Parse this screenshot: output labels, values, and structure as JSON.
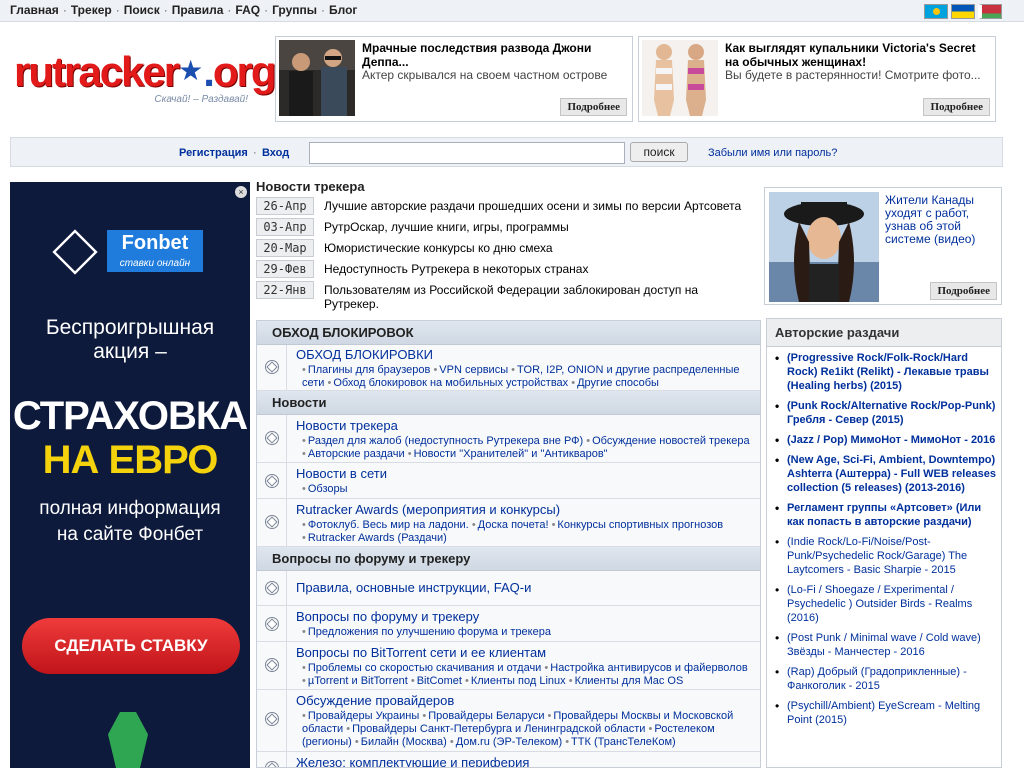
{
  "nav": {
    "items": [
      "Главная",
      "Трекер",
      "Поиск",
      "Правила",
      "FAQ",
      "Группы",
      "Блог"
    ],
    "sep": "·"
  },
  "logo": {
    "part1": "rutracker",
    "star": "★",
    "part2": "org",
    "dot": ".",
    "tagline": "Скачай! – Раздавай!"
  },
  "top_ads": [
    {
      "title": "Мрачные последствия развода Джони Деппа...",
      "desc": "Актер скрывался на своем частном острове",
      "more": "Подробнее"
    },
    {
      "title": "Как выглядят купальники Victoria's Secret на обычных женщинах!",
      "desc": "Вы будете в растерянности! Смотрите фото...",
      "more": "Подробнее"
    }
  ],
  "login": {
    "register": "Регистрация",
    "dot": "·",
    "enter": "Вход",
    "search_value": "",
    "search_button": "поиск",
    "forgot": "Забыли имя или пароль?"
  },
  "banner": {
    "close": "×",
    "brand": "Fonbet",
    "brand_sub": "ставки онлайн",
    "line1": "Беспроигрышная",
    "line2": "акция –",
    "big1": "СТРАХОВКА",
    "big2": "НА ЕВРО",
    "line3": "полная информация",
    "line4": "на сайте Фонбет",
    "cta": "СДЕЛАТЬ СТАВКУ"
  },
  "news": {
    "title": "Новости трекера",
    "items": [
      {
        "date": "26-Апр",
        "text": "Лучшие авторские раздачи прошедших осени и зимы по версии Артсовета"
      },
      {
        "date": "03-Апр",
        "text": "РутрОскар, лучшие книги, игры, программы"
      },
      {
        "date": "20-Мар",
        "text": "Юмористические конкурсы ко дню смеха"
      },
      {
        "date": "29-Фев",
        "text": "Недоступность Рутрекера в некоторых странах"
      },
      {
        "date": "22-Янв",
        "text": "Пользователям из Российской Федерации заблокирован доступ на Рутрекер."
      }
    ]
  },
  "right_ad": {
    "title": "Жители Канады уходят с работ, узнав об этой системе (видео)",
    "more": "Подробнее"
  },
  "forum": {
    "cat1": "ОБХОД БЛОКИРОВОК",
    "f1": {
      "name": "ОБХОД БЛОКИРОВКИ",
      "sub1": "Плагины для браузеров",
      "sub2": "VPN сервисы",
      "sub3": "TOR, I2P, ONION и другие распределенные сети",
      "sub4": "Обход блокировок на мобильных устройствах",
      "sub5": "Другие способы"
    },
    "cat2": "Новости",
    "f2": {
      "name": "Новости трекера",
      "sub1": "Раздел для жалоб (недоступность Рутрекера вне РФ)",
      "sub2": "Обсуждение новостей трекера",
      "sub3": "Авторские раздачи",
      "sub4": "Новости \"Хранителей\" и \"Антикваров\""
    },
    "f3": {
      "name": "Новости в сети",
      "sub1": "Обзоры"
    },
    "f4": {
      "name": "Rutracker Awards (мероприятия и конкурсы)",
      "sub1": "Фотоклуб. Весь мир на ладони.",
      "sub2": "Доска почета!",
      "sub3": "Конкурсы спортивных прогнозов",
      "sub4": "Rutracker Awards (Раздачи)"
    },
    "cat3": "Вопросы по форуму и трекеру",
    "f5": {
      "name": "Правила, основные инструкции, FAQ-и"
    },
    "f6": {
      "name": "Вопросы по форуму и трекеру",
      "sub1": "Предложения по улучшению форума и трекера"
    },
    "f7": {
      "name": "Вопросы по BitTorrent сети и ее клиентам",
      "sub1": "Проблемы со скоростью скачивания и отдачи",
      "sub2": "Настройка антивирусов и файерволов",
      "sub3": "µTorrent и BitTorrent",
      "sub4": "BitComet",
      "sub5": "Клиенты под Linux",
      "sub6": "Клиенты для Mac OS"
    },
    "f8": {
      "name": "Обсуждение провайдеров",
      "sub1": "Провайдеры Украины",
      "sub2": "Провайдеры Беларуси",
      "sub3": "Провайдеры Москвы и Московской области",
      "sub4": "Провайдеры Санкт-Петербурга и Ленинградской области",
      "sub5": "Ростелеком (регионы)",
      "sub6": "Билайн (Москва)",
      "sub7": "Дом.ru (ЭР-Телеком)",
      "sub8": "ТТК (ТрансТелеКом)"
    },
    "f9": {
      "name": "Железо: комплектующие и периферия"
    }
  },
  "sidebar": {
    "title": "Авторские раздачи",
    "items": [
      "(Progressive Rock/Folk-Rock/Hard Rock) Re1ikt (Relikt) - Лекавые травы (Healing herbs) (2015)",
      "(Punk Rock/Alternative Rock/Pop-Punk) Гребля - Север (2015)",
      "(Jazz / Pop) МимоНот - МимоНот - 2016",
      "(New Age, Sci-Fi, Ambient, Downtempo) Ashterra (Аштерра) - Full WEB releases collection (5 releases) (2013-2016)",
      "Регламент группы «Артсовет» (Или как попасть в авторские раздачи)",
      "(Indie Rock/Lo-Fi/Noise/Post-Punk/Psychedelic Rock/Garage) The Laytcomers - Basic Sharpie - 2015",
      "(Lo-Fi / Shoegaze / Experimental / Psychedelic ) Outsider Birds - Realms (2016)",
      "(Post Punk / Minimal wave / Cold wave) Звёзды - Манчестер - 2016",
      "(Rap) Добрый (Градоприкленные) - Фанкоголик - 2015",
      "(Psychill/Ambient) EyeScream - Melting Point (2015)"
    ]
  }
}
